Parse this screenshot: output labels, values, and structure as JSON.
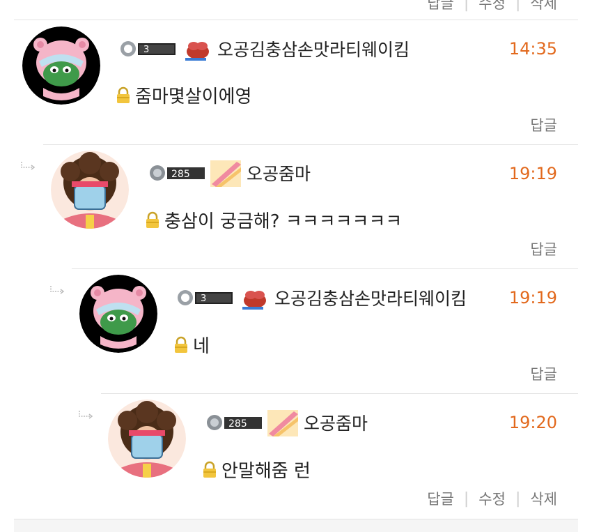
{
  "top_actions": {
    "reply": "답글",
    "edit": "수정",
    "delete": "삭제"
  },
  "comments": [
    {
      "level_text": "3",
      "nickname": "오공김충삼손맛라티웨이킴",
      "time": "14:35",
      "content": "줌마몇살이에영",
      "actions": {
        "reply": "답글"
      },
      "avatar": "pink-hood-frog-avatar",
      "item_icon": "red-frog-icon"
    },
    {
      "level_text": "285",
      "nickname": "오공줌마",
      "time": "19:19",
      "content": "충삼이 궁금해? ㅋㅋㅋㅋㅋㅋㅋ",
      "actions": {
        "reply": "답글"
      },
      "avatar": "afro-visor-avatar",
      "item_icon": "pink-stripe-icon"
    },
    {
      "level_text": "3",
      "nickname": "오공김충삼손맛라티웨이킴",
      "time": "19:19",
      "content": "네",
      "actions": {
        "reply": "답글"
      },
      "avatar": "pink-hood-frog-avatar",
      "item_icon": "red-frog-icon"
    },
    {
      "level_text": "285",
      "nickname": "오공줌마",
      "time": "19:20",
      "content": "안말해줌 런",
      "actions": {
        "reply": "답글",
        "edit": "수정",
        "delete": "삭제"
      },
      "avatar": "afro-visor-avatar",
      "item_icon": "pink-stripe-icon"
    }
  ],
  "colors": {
    "time": "#e2691d",
    "action": "#777777",
    "divider": "#e3e3e3"
  }
}
